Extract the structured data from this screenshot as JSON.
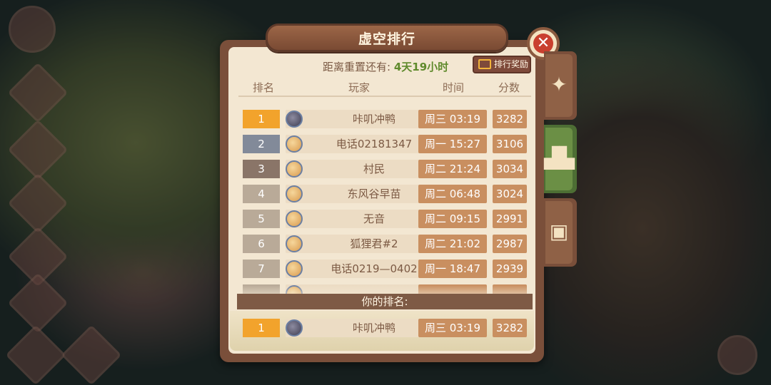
{
  "title": "虚空排行",
  "reset": {
    "label": "距离重置还有:",
    "value": "4天19小时"
  },
  "reward_button": "排行奖励",
  "columns": {
    "rank": "排名",
    "player": "玩家",
    "time": "时间",
    "score": "分数"
  },
  "rows": [
    {
      "rank": "1",
      "name": "咔叽冲鸭",
      "time": "周三 03:19",
      "score": "3282"
    },
    {
      "rank": "2",
      "name": "电话02181347",
      "time": "周一 15:27",
      "score": "3106"
    },
    {
      "rank": "3",
      "name": "村民",
      "time": "周二 21:24",
      "score": "3034"
    },
    {
      "rank": "4",
      "name": "东风谷早苗",
      "time": "周二 06:48",
      "score": "3024"
    },
    {
      "rank": "5",
      "name": "无音",
      "time": "周二 09:15",
      "score": "2991"
    },
    {
      "rank": "6",
      "name": "狐狸君#2",
      "time": "周二 21:02",
      "score": "2987"
    },
    {
      "rank": "7",
      "name": "电话0219—0402",
      "time": "周一 18:47",
      "score": "2939"
    }
  ],
  "my_rank": {
    "label": "你的排名:",
    "rank": "1",
    "name": "咔叽冲鸭",
    "time": "周三 03:19",
    "score": "3282"
  },
  "icons": {
    "close": "close-icon",
    "tab1": "shuriken-icon",
    "tab2": "podium-icon",
    "tab3": "chest-icon",
    "reward": "chest-icon"
  },
  "colors": {
    "rank1": "#f2a32c",
    "rank2": "#828a99",
    "rank3": "#8a7568",
    "reset_value": "#5f8a2c",
    "active_tab": "#6b8f45"
  }
}
